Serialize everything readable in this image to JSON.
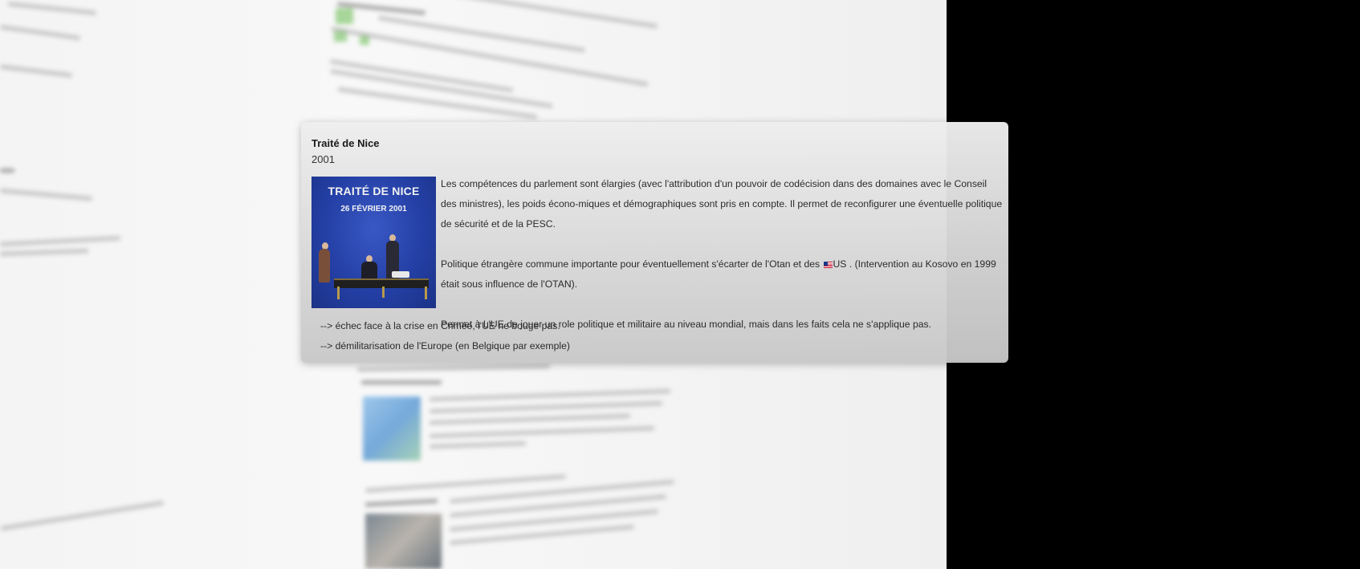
{
  "card": {
    "title": "Traité de Nice",
    "year": "2001",
    "image": {
      "title": "TRAITÉ DE NICE",
      "date": "26 FÉVRIER 2001"
    },
    "paragraphs": [
      "Les compétences du parlement sont élargies (avec l'attribution d'un pouvoir de codécision dans des domaines avec le Conseil des ministres), les poids écono-miques et démographiques sont pris en compte. Il permet de reconfigurer une éventuelle politique de sécurité et de la PESC.",
      "Politique étrangère commune importante pour éventuellement s'écarter de l'Otan et des",
      "US . (Intervention au Kosovo en 1999 était sous influence de l'OTAN).",
      "Permet à L'UE de jouer un role politique et militaire au niveau mondial, mais dans les faits cela ne s'applique pas."
    ],
    "bullets": [
      "--> échec face à la crise en Crimée, l'UE ne bouge pas.",
      "--> démilitarisation de l'Europe (en Belgique par exemple)"
    ]
  },
  "colors": {
    "photo_background": "#2440a6",
    "card_background": "#e0e0e0",
    "outside": "#000000"
  },
  "icons": [
    "us-flag-icon"
  ]
}
